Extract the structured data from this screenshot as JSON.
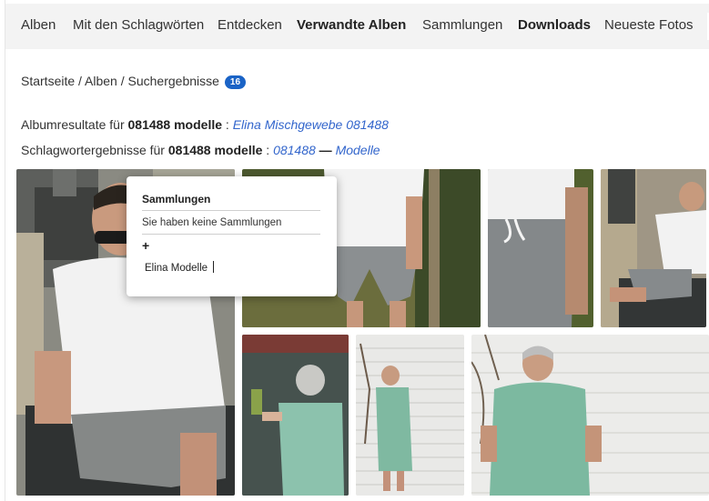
{
  "nav": {
    "items": [
      {
        "label": "Alben",
        "bold": false
      },
      {
        "label": "Mit den Schlagwörten",
        "bold": false
      },
      {
        "label": "Entdecken",
        "bold": false
      },
      {
        "label": "Verwandte Alben",
        "bold": true
      },
      {
        "label": "Sammlungen",
        "bold": false
      },
      {
        "label": "Downloads",
        "bold": true
      },
      {
        "label": "Neueste Fotos",
        "bold": false
      }
    ]
  },
  "breadcrumb": {
    "text": "Startseite / Alben / Suchergebnisse",
    "count": "16"
  },
  "album_results": {
    "prefix": "Albumresultate für",
    "query": "081488 modelle",
    "colon": ":",
    "link": "Elina Mischgewebe 081488"
  },
  "tag_results": {
    "prefix": "Schlagwortergebnisse für",
    "query": "081488 modelle",
    "colon": ":",
    "link1": "081488",
    "dash": "—",
    "link2": "Modelle"
  },
  "popup": {
    "title": "Sammlungen",
    "empty_text": "Sie haben keine Sammlungen",
    "add_symbol": "+",
    "new_collection_value": "Elina Modelle"
  },
  "photos": [
    {
      "name": "man-chair-sunglasses"
    },
    {
      "name": "grey-shorts-legs"
    },
    {
      "name": "shorts-drawstring-closeup"
    },
    {
      "name": "man-lounging-stove"
    },
    {
      "name": "woman-green-dress-back"
    },
    {
      "name": "woman-green-dress-brick-wall"
    },
    {
      "name": "woman-green-dress-closeup"
    }
  ]
}
